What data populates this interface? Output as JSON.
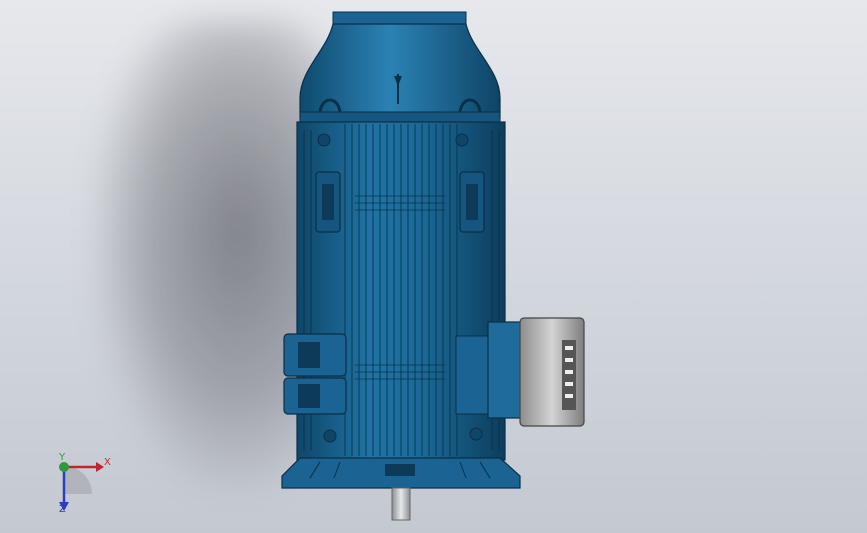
{
  "triad": {
    "x_label": "X",
    "y_label": "Y",
    "z_label": "Z",
    "x_color": "#c0262d",
    "y_color": "#2d9b3a",
    "z_color": "#2a3fbf"
  },
  "model": {
    "body_color": "#1e6694",
    "body_dark": "#0f3f60",
    "terminal_box_color": "#9a9a9a"
  }
}
